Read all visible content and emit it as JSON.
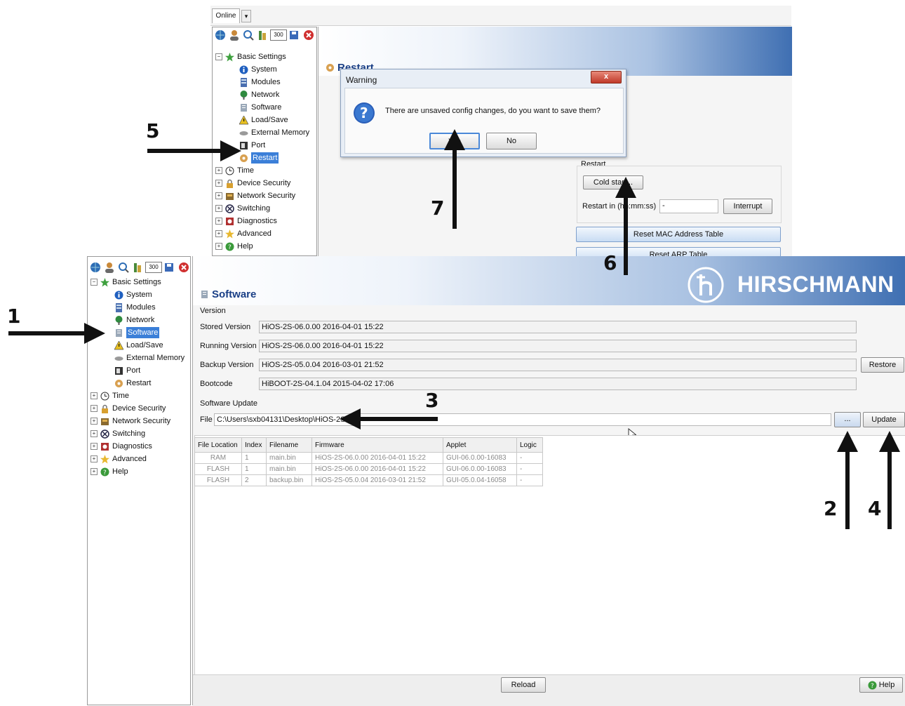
{
  "top": {
    "tab_label": "Online",
    "toolbar_value": "300",
    "tree": [
      {
        "label": "Basic Settings",
        "icon": "star-icon"
      },
      {
        "label": "System",
        "icon": "info-icon"
      },
      {
        "label": "Modules",
        "icon": "modules-icon"
      },
      {
        "label": "Network",
        "icon": "network-icon"
      },
      {
        "label": "Software",
        "icon": "software-icon"
      },
      {
        "label": "Load/Save",
        "icon": "warning-icon"
      },
      {
        "label": "External Memory",
        "icon": "memory-icon"
      },
      {
        "label": "Port",
        "icon": "port-icon"
      },
      {
        "label": "Restart",
        "icon": "restart-icon"
      },
      {
        "label": "Time",
        "icon": "clock-icon"
      },
      {
        "label": "Device Security",
        "icon": "lock-icon"
      },
      {
        "label": "Network Security",
        "icon": "shield-icon"
      },
      {
        "label": "Switching",
        "icon": "switching-icon"
      },
      {
        "label": "Diagnostics",
        "icon": "diagnostics-icon"
      },
      {
        "label": "Advanced",
        "icon": "star-icon"
      },
      {
        "label": "Help",
        "icon": "help-icon"
      }
    ],
    "page_title": "Restart",
    "dialog": {
      "title": "Warning",
      "message": "There are unsaved config changes, do you want to save them?",
      "yes": "Yes",
      "no": "No",
      "close": "x"
    },
    "restart_group": "Restart",
    "cold_start": "Cold start...",
    "restart_in": "Restart in (hh:mm:ss)",
    "restart_value": "-",
    "interrupt": "Interrupt",
    "reset_mac": "Reset MAC Address Table",
    "reset_arp": "Reset ARP Table"
  },
  "bottom": {
    "toolbar_value": "300",
    "tree": [
      {
        "label": "Basic Settings"
      },
      {
        "label": "System"
      },
      {
        "label": "Modules"
      },
      {
        "label": "Network"
      },
      {
        "label": "Software"
      },
      {
        "label": "Load/Save"
      },
      {
        "label": "External Memory"
      },
      {
        "label": "Port"
      },
      {
        "label": "Restart"
      },
      {
        "label": "Time"
      },
      {
        "label": "Device Security"
      },
      {
        "label": "Network Security"
      },
      {
        "label": "Switching"
      },
      {
        "label": "Diagnostics"
      },
      {
        "label": "Advanced"
      },
      {
        "label": "Help"
      }
    ],
    "page_title": "Software",
    "brand": "HIRSCHMANN",
    "version_group": "Version",
    "stored_label": "Stored Version",
    "stored_value": "HiOS-2S-06.0.00 2016-04-01 15:22",
    "running_label": "Running Version",
    "running_value": "HiOS-2S-06.0.00 2016-04-01 15:22",
    "backup_label": "Backup Version",
    "backup_value": "HiOS-2S-05.0.04 2016-03-01 21:52",
    "restore": "Restore",
    "bootcode_label": "Bootcode",
    "bootcode_value": "HiBOOT-2S-04.1.04 2015-04-02 17:06",
    "update_group": "Software Update",
    "file_label": "File",
    "file_value": "C:\\Users\\sxb04131\\Desktop\\HiOS-2S",
    "browse": "...",
    "update": "Update",
    "table": {
      "headers": [
        "File Location",
        "Index",
        "Filename",
        "Firmware",
        "Applet",
        "Logic"
      ],
      "rows": [
        [
          "RAM",
          "1",
          "main.bin",
          "HiOS-2S-06.0.00 2016-04-01 15:22",
          "GUI-06.0.00-16083",
          "-"
        ],
        [
          "FLASH",
          "1",
          "main.bin",
          "HiOS-2S-06.0.00 2016-04-01 15:22",
          "GUI-06.0.00-16083",
          "-"
        ],
        [
          "FLASH",
          "2",
          "backup.bin",
          "HiOS-2S-05.0.04 2016-03-01 21:52",
          "GUI-05.0.04-16058",
          "-"
        ]
      ]
    },
    "reload": "Reload",
    "help": "Help"
  },
  "annotations": [
    "1",
    "2",
    "3",
    "4",
    "5",
    "6",
    "7"
  ]
}
